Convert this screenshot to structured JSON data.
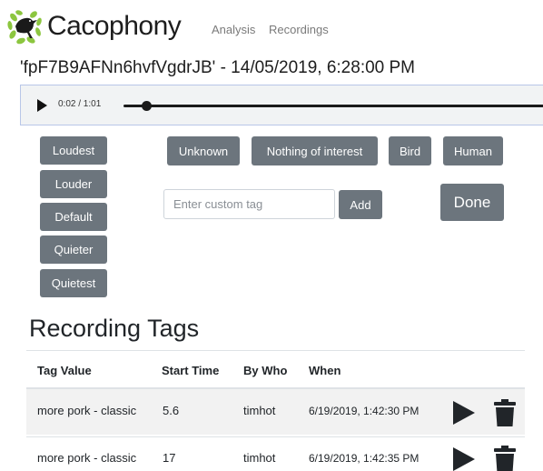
{
  "header": {
    "brand": "Cacophony",
    "logo_icon": "bird-on-leaves-icon",
    "nav": [
      {
        "label": "Analysis"
      },
      {
        "label": "Recordings"
      }
    ]
  },
  "recording": {
    "title": "'fpF7B9AFNn6hvfVgdrJB' - 14/05/2019, 6:28:00 PM"
  },
  "player": {
    "time_display": "0:02 / 1:01",
    "progress": 0.033,
    "play_icon": "play-icon"
  },
  "volume_buttons": [
    {
      "label": "Loudest"
    },
    {
      "label": "Louder"
    },
    {
      "label": "Default"
    },
    {
      "label": "Quieter"
    },
    {
      "label": "Quietest"
    }
  ],
  "quick_tags": [
    {
      "label": "Unknown"
    },
    {
      "label": "Nothing of interest"
    },
    {
      "label": "Bird"
    },
    {
      "label": "Human"
    }
  ],
  "custom_tag": {
    "placeholder": "Enter custom tag",
    "value": "",
    "add_label": "Add"
  },
  "done_label": "Done",
  "recording_tags": {
    "title": "Recording Tags",
    "columns": [
      "Tag Value",
      "Start Time",
      "By Who",
      "When"
    ],
    "rows": [
      {
        "tag": "more pork - classic",
        "start": "5.6",
        "who": "timhot",
        "when": "6/19/2019, 1:42:30 PM"
      },
      {
        "tag": "more pork - classic",
        "start": "17",
        "who": "timhot",
        "when": "6/19/2019, 1:42:35 PM"
      }
    ]
  },
  "colors": {
    "button_gray": "#6c757d",
    "brand_green": "#8cc63f",
    "player_border": "#b8c6e8"
  }
}
